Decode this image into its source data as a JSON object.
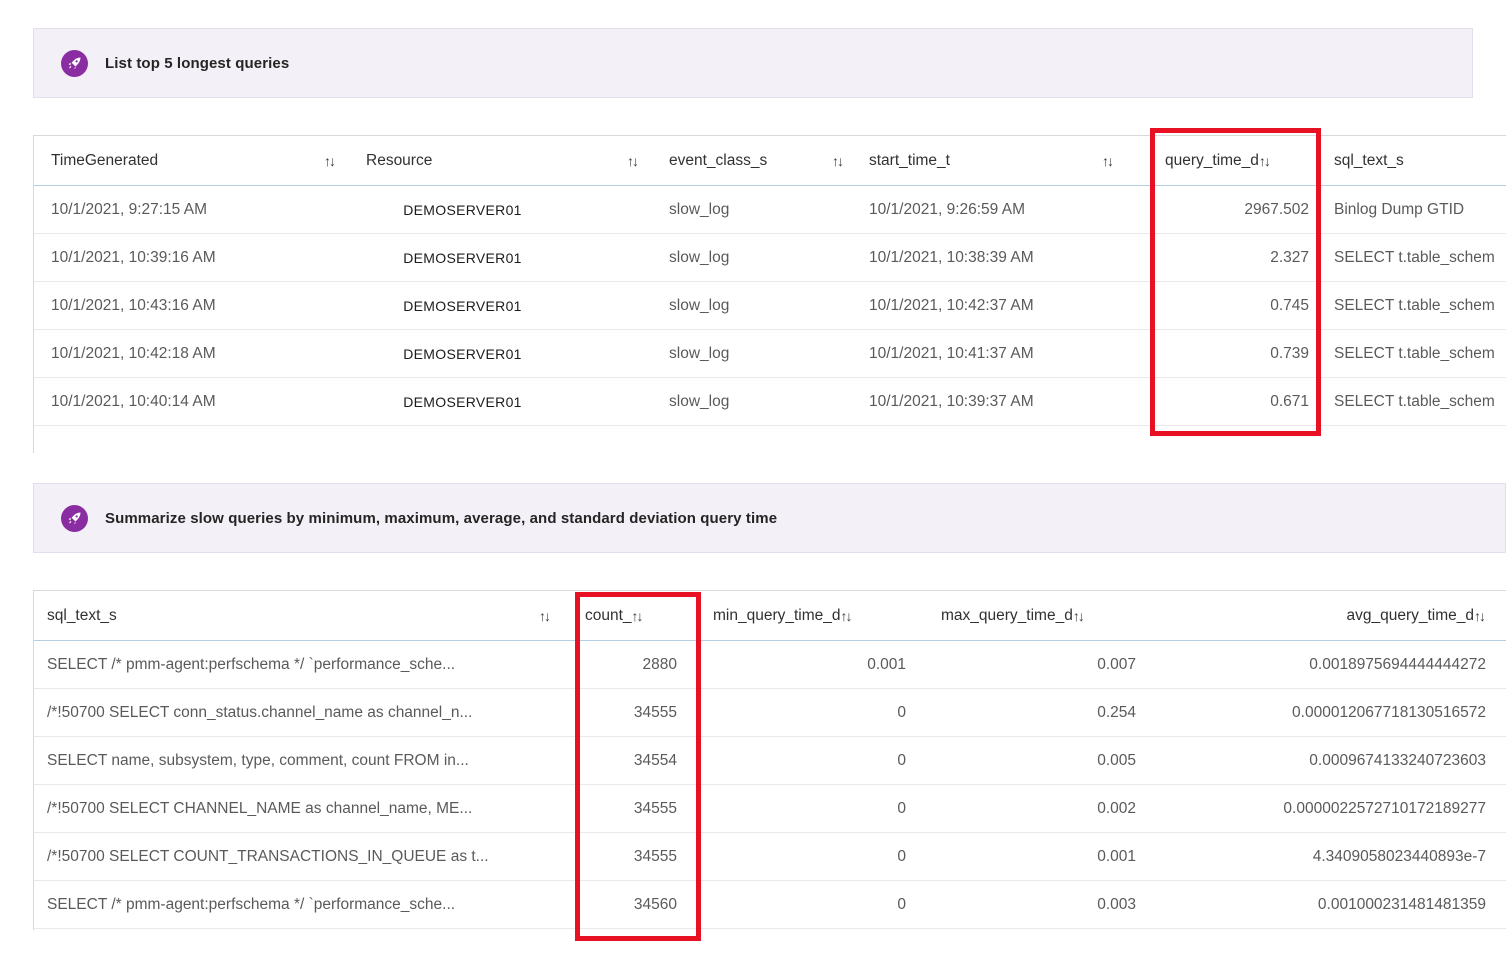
{
  "colors": {
    "accent_purple": "#8A2DA2",
    "highlight_red": "#E81123",
    "banner_background": "#F4F0F7"
  },
  "icons": {
    "sort": "↑↓",
    "banner": "rocket-icon"
  },
  "banners": [
    {
      "label": "List top 5 longest queries"
    },
    {
      "label": "Summarize slow queries by minimum, maximum, average, and standard deviation query time"
    }
  ],
  "table1": {
    "columns": [
      {
        "label": "TimeGenerated"
      },
      {
        "label": "Resource"
      },
      {
        "label": "event_class_s"
      },
      {
        "label": "start_time_t"
      },
      {
        "label": "query_time_d"
      },
      {
        "label": "sql_text_s"
      }
    ],
    "rows": [
      {
        "time_generated": "10/1/2021, 9:27:15 AM",
        "resource": "DEMOSERVER01",
        "event_class_s": "slow_log",
        "start_time_t": "10/1/2021, 9:26:59 AM",
        "query_time_d": "2967.502",
        "sql_text_s": "Binlog Dump GTID"
      },
      {
        "time_generated": "10/1/2021, 10:39:16 AM",
        "resource": "DEMOSERVER01",
        "event_class_s": "slow_log",
        "start_time_t": "10/1/2021, 10:38:39 AM",
        "query_time_d": "2.327",
        "sql_text_s": "SELECT t.table_schem"
      },
      {
        "time_generated": "10/1/2021, 10:43:16 AM",
        "resource": "DEMOSERVER01",
        "event_class_s": "slow_log",
        "start_time_t": "10/1/2021, 10:42:37 AM",
        "query_time_d": "0.745",
        "sql_text_s": "SELECT t.table_schem"
      },
      {
        "time_generated": "10/1/2021, 10:42:18 AM",
        "resource": "DEMOSERVER01",
        "event_class_s": "slow_log",
        "start_time_t": "10/1/2021, 10:41:37 AM",
        "query_time_d": "0.739",
        "sql_text_s": "SELECT t.table_schem"
      },
      {
        "time_generated": "10/1/2021, 10:40:14 AM",
        "resource": "DEMOSERVER01",
        "event_class_s": "slow_log",
        "start_time_t": "10/1/2021, 10:39:37 AM",
        "query_time_d": "0.671",
        "sql_text_s": "SELECT t.table_schem"
      }
    ]
  },
  "table2": {
    "columns": [
      {
        "label": "sql_text_s"
      },
      {
        "label": "count_"
      },
      {
        "label": "min_query_time_d"
      },
      {
        "label": "max_query_time_d"
      },
      {
        "label": "avg_query_time_d"
      }
    ],
    "rows": [
      {
        "sql_text_s": "SELECT /* pmm-agent:perfschema */ `performance_sche...",
        "count": "2880",
        "min_query_time_d": "0.001",
        "max_query_time_d": "0.007",
        "avg_query_time_d": "0.0018975694444444272"
      },
      {
        "sql_text_s": "/*!50700 SELECT conn_status.channel_name as channel_n...",
        "count": "34555",
        "min_query_time_d": "0",
        "max_query_time_d": "0.254",
        "avg_query_time_d": "0.000012067718130516572"
      },
      {
        "sql_text_s": "SELECT name, subsystem, type, comment, count FROM in...",
        "count": "34554",
        "min_query_time_d": "0",
        "max_query_time_d": "0.005",
        "avg_query_time_d": "0.0009674133240723603"
      },
      {
        "sql_text_s": "/*!50700 SELECT CHANNEL_NAME as channel_name, ME...",
        "count": "34555",
        "min_query_time_d": "0",
        "max_query_time_d": "0.002",
        "avg_query_time_d": "0.0000022572710172189277"
      },
      {
        "sql_text_s": "/*!50700 SELECT COUNT_TRANSACTIONS_IN_QUEUE as t...",
        "count": "34555",
        "min_query_time_d": "0",
        "max_query_time_d": "0.001",
        "avg_query_time_d": "4.3409058023440893e-7"
      },
      {
        "sql_text_s": "SELECT /* pmm-agent:perfschema */ `performance_sche...",
        "count": "34560",
        "min_query_time_d": "0",
        "max_query_time_d": "0.003",
        "avg_query_time_d": "0.001000231481481359"
      }
    ]
  }
}
